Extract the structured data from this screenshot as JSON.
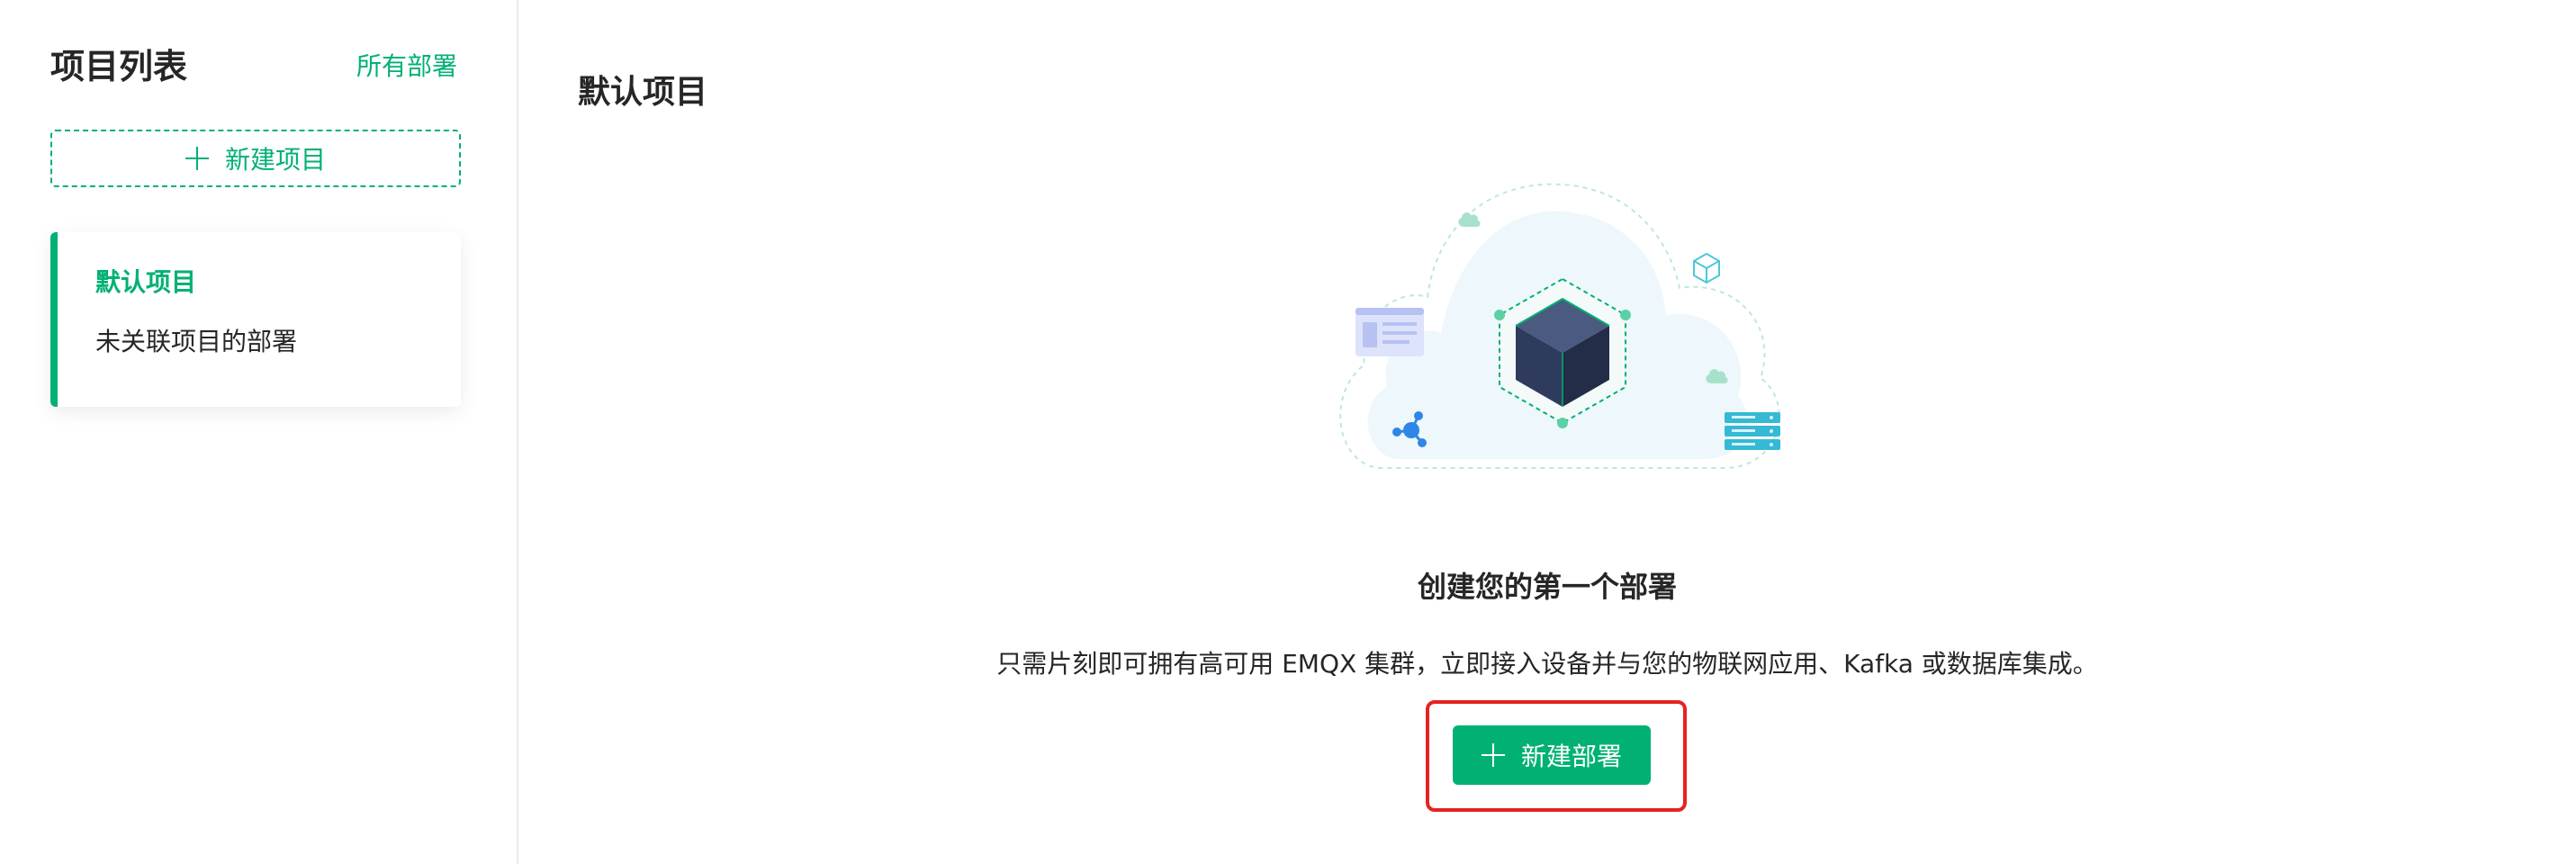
{
  "sidebar": {
    "title": "项目列表",
    "all_deployments_link": "所有部署",
    "new_project_label": "新建项目",
    "projects": [
      {
        "name": "默认项目",
        "description": "未关联项目的部署"
      }
    ]
  },
  "main": {
    "title": "默认项目",
    "empty_state": {
      "title": "创建您的第一个部署",
      "description": "只需片刻即可拥有高可用 EMQX 集群，立即接入设备并与您的物联网应用、Kafka 或数据库集成。",
      "new_deployment_label": "新建部署"
    }
  },
  "colors": {
    "accent": "#00b173",
    "highlight": "#e62222",
    "text": "#262626"
  }
}
